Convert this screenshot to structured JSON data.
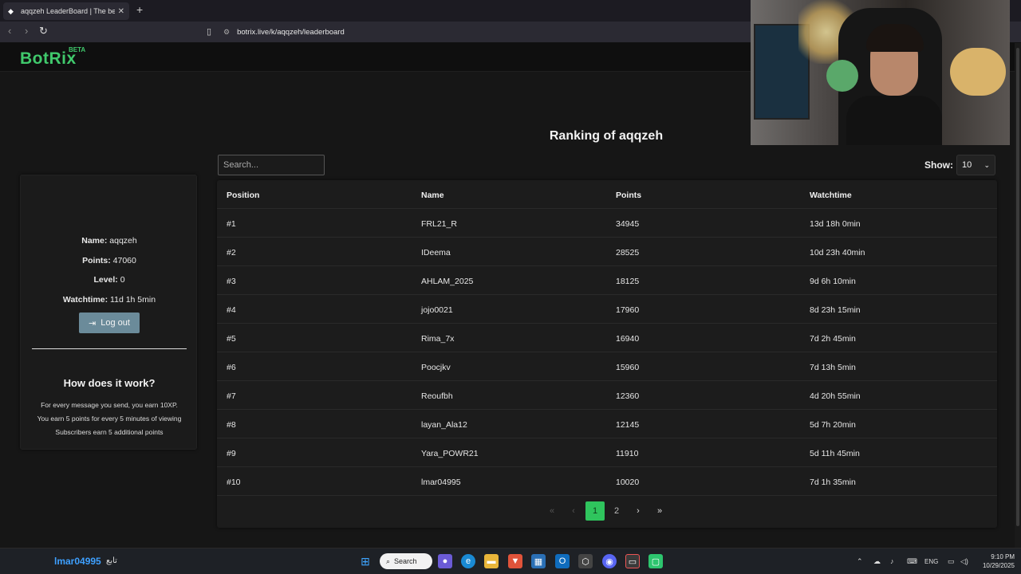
{
  "browser": {
    "tab_title": "aqqzeh LeaderBoard | The best",
    "url": "botrix.live/k/aqqzeh/leaderboard"
  },
  "site": {
    "logo": "BotRix",
    "beta": "BETA",
    "ranking_title": "Ranking of aqqzeh",
    "search_placeholder": "Search...",
    "show_label": "Show:",
    "show_value": "10"
  },
  "profile": {
    "name_label": "Name:",
    "name": "aqqzeh",
    "points_label": "Points:",
    "points": "47060",
    "level_label": "Level:",
    "level": "0",
    "watchtime_label": "Watchtime:",
    "watchtime": "11d 1h 5min",
    "logout_label": "Log out"
  },
  "how": {
    "title": "How does it work?",
    "lines": [
      "For every message you send, you earn 10XP.",
      "You earn 5 points for every 5 minutes of viewing",
      "Subscribers earn 5 additional points"
    ]
  },
  "table": {
    "columns": [
      "Position",
      "Name",
      "Points",
      "Watchtime"
    ],
    "rows": [
      [
        "#1",
        "FRL21_R",
        "34945",
        "13d 18h 0min"
      ],
      [
        "#2",
        "IDeema",
        "28525",
        "10d 23h 40min"
      ],
      [
        "#3",
        "AHLAM_2025",
        "18125",
        "9d 6h 10min"
      ],
      [
        "#4",
        "jojo0021",
        "17960",
        "8d 23h 15min"
      ],
      [
        "#5",
        "Rima_7x",
        "16940",
        "7d 2h 45min"
      ],
      [
        "#6",
        "Poocjkv",
        "15960",
        "7d 13h 5min"
      ],
      [
        "#7",
        "Reoufbh",
        "12360",
        "4d 20h 55min"
      ],
      [
        "#8",
        "layan_Ala12",
        "12145",
        "5d 7h 20min"
      ],
      [
        "#9",
        "Yara_POWR21",
        "11910",
        "5d 11h 45min"
      ],
      [
        "#10",
        "lmar04995",
        "10020",
        "7d 1h 35min"
      ]
    ]
  },
  "pagination": {
    "first": "«",
    "prev": "‹",
    "page1": "1",
    "page2": "2",
    "next": "›",
    "last": "»"
  },
  "taskbar": {
    "overlay_user": "lmar04995",
    "overlay_text": "تابع",
    "search": "Search",
    "lang": "ENG",
    "time": "9:10 PM",
    "date": "10/29/2025"
  }
}
